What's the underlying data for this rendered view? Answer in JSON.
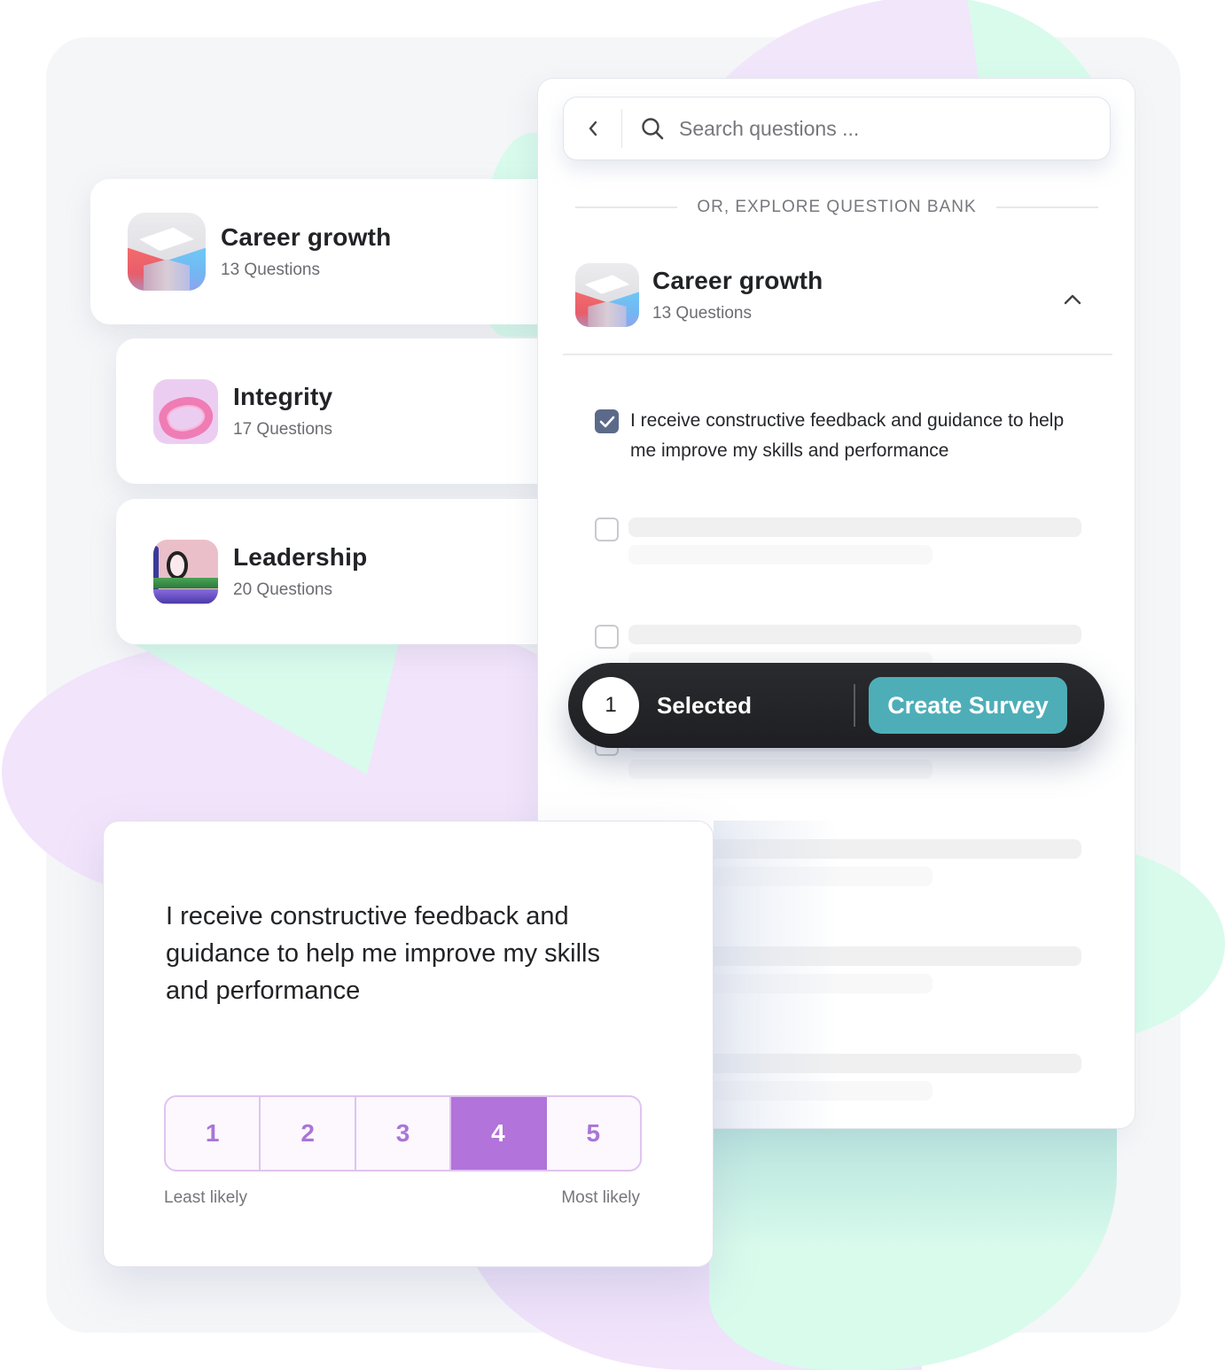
{
  "colors": {
    "accent_teal": "#4eaeb8",
    "rating_purple": "#b273da",
    "checkbox_checked": "#5c6a8a",
    "selection_bar": "#1e1f22"
  },
  "categories": [
    {
      "title": "Career growth",
      "subtitle": "13 Questions",
      "icon": "career-growth-cube-icon",
      "active": true
    },
    {
      "title": "Integrity",
      "subtitle": "17 Questions",
      "icon": "integrity-ring-icon",
      "active": false
    },
    {
      "title": "Leadership",
      "subtitle": "20 Questions",
      "icon": "leadership-nut-icon",
      "active": false
    }
  ],
  "question_bank": {
    "back_icon": "chevron-left-icon",
    "search_icon": "search-icon",
    "search_placeholder": "Search questions ...",
    "search_value": "",
    "divider_text": "OR, EXPLORE QUESTION BANK",
    "section": {
      "title": "Career growth",
      "subtitle": "13 Questions",
      "expanded": true,
      "toggle_icon": "chevron-up-icon"
    },
    "questions": [
      {
        "text": "I receive constructive feedback and guidance to help me improve my skills and performance",
        "checked": true,
        "loading": false
      },
      {
        "text": "",
        "checked": false,
        "loading": true
      },
      {
        "text": "",
        "checked": false,
        "loading": true
      },
      {
        "text": "",
        "checked": false,
        "loading": true
      },
      {
        "text": "",
        "checked": false,
        "loading": true
      },
      {
        "text": "",
        "checked": false,
        "loading": true
      },
      {
        "text": "",
        "checked": false,
        "loading": true
      }
    ]
  },
  "selection_bar": {
    "count": "1",
    "label": "Selected",
    "button_label": "Create Survey"
  },
  "preview": {
    "question": "I receive constructive feedback and guidance to help me improve my skills and performance",
    "scale": [
      "1",
      "2",
      "3",
      "4",
      "5"
    ],
    "selected_value": "4",
    "min_label": "Least likely",
    "max_label": "Most likely"
  }
}
